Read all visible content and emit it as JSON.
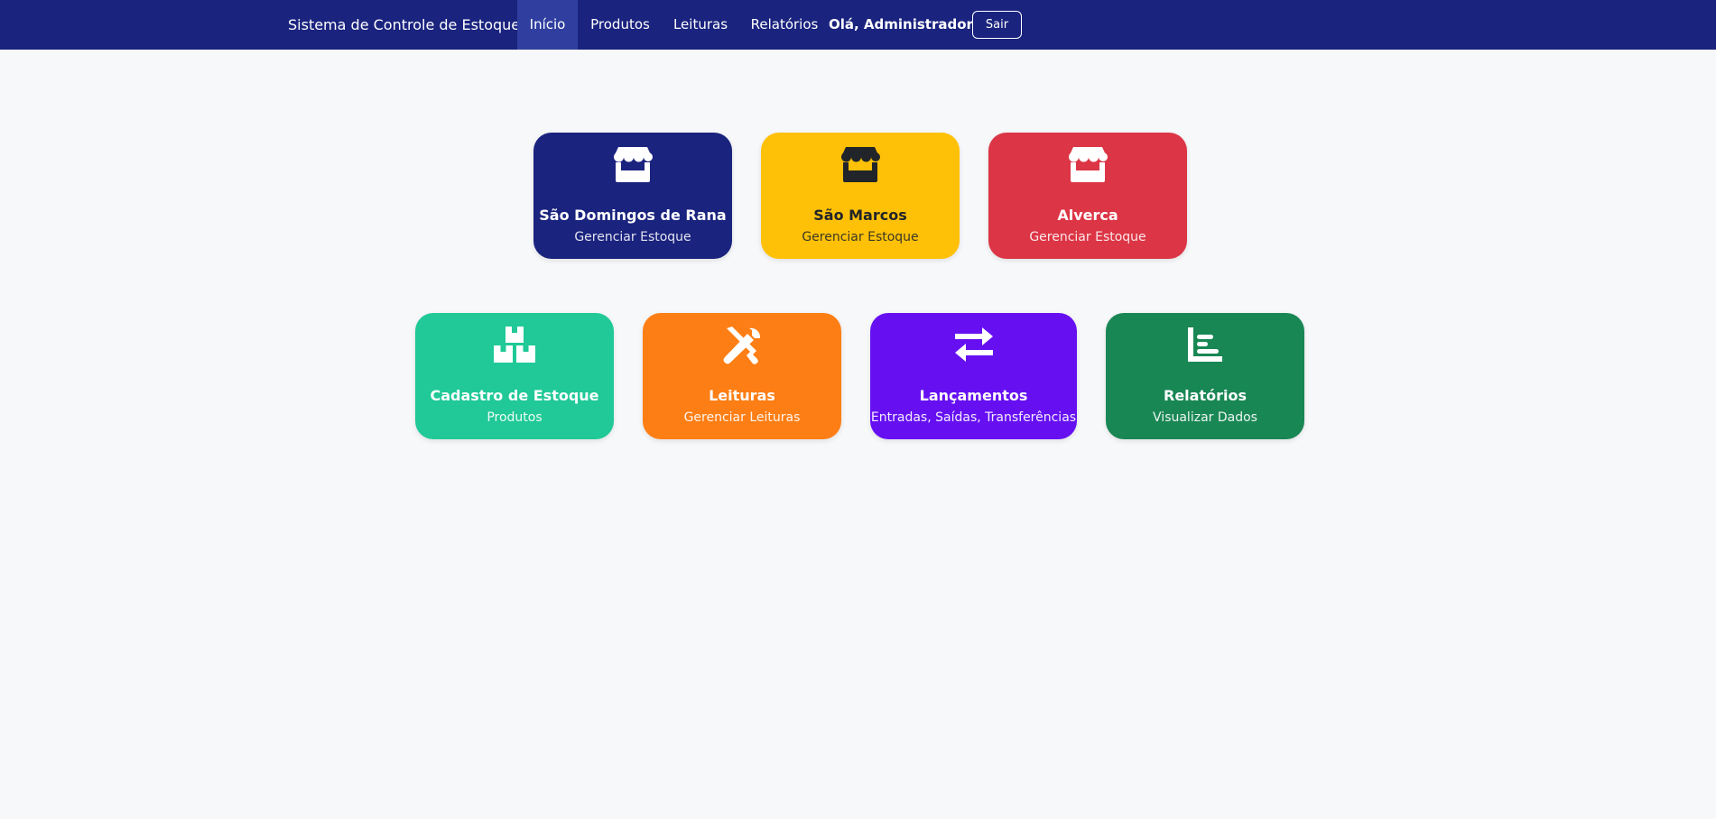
{
  "navbar": {
    "brand": "Sistema de Controle de Estoque",
    "items": [
      {
        "label": "Início",
        "active": true
      },
      {
        "label": "Produtos",
        "active": false
      },
      {
        "label": "Leituras",
        "active": false
      },
      {
        "label": "Relatórios",
        "active": false
      }
    ],
    "greeting": "Olá, Administrador",
    "logout_label": "Sair"
  },
  "stores": [
    {
      "title": "São Domingos de Rana",
      "subtitle": "Gerenciar Estoque",
      "color": "#1a237e",
      "text_color": "#ffffff",
      "icon": "store-icon"
    },
    {
      "title": "São Marcos",
      "subtitle": "Gerenciar Estoque",
      "color": "#ffc107",
      "text_color": "#212529",
      "icon": "store-icon"
    },
    {
      "title": "Alverca",
      "subtitle": "Gerenciar Estoque",
      "color": "#dc3545",
      "text_color": "#ffffff",
      "icon": "store-icon"
    }
  ],
  "modules": [
    {
      "title": "Cadastro de Estoque",
      "subtitle": "Produtos",
      "color": "#20c997",
      "icon": "boxes-icon"
    },
    {
      "title": "Leituras",
      "subtitle": "Gerenciar Leituras",
      "color": "#fd7e14",
      "icon": "tools-icon"
    },
    {
      "title": "Lançamentos",
      "subtitle": "Entradas, Saídas, Transferências",
      "color": "#6610f2",
      "icon": "exchange-icon"
    },
    {
      "title": "Relatórios",
      "subtitle": "Visualizar Dados",
      "color": "#198754",
      "icon": "chart-icon"
    }
  ]
}
